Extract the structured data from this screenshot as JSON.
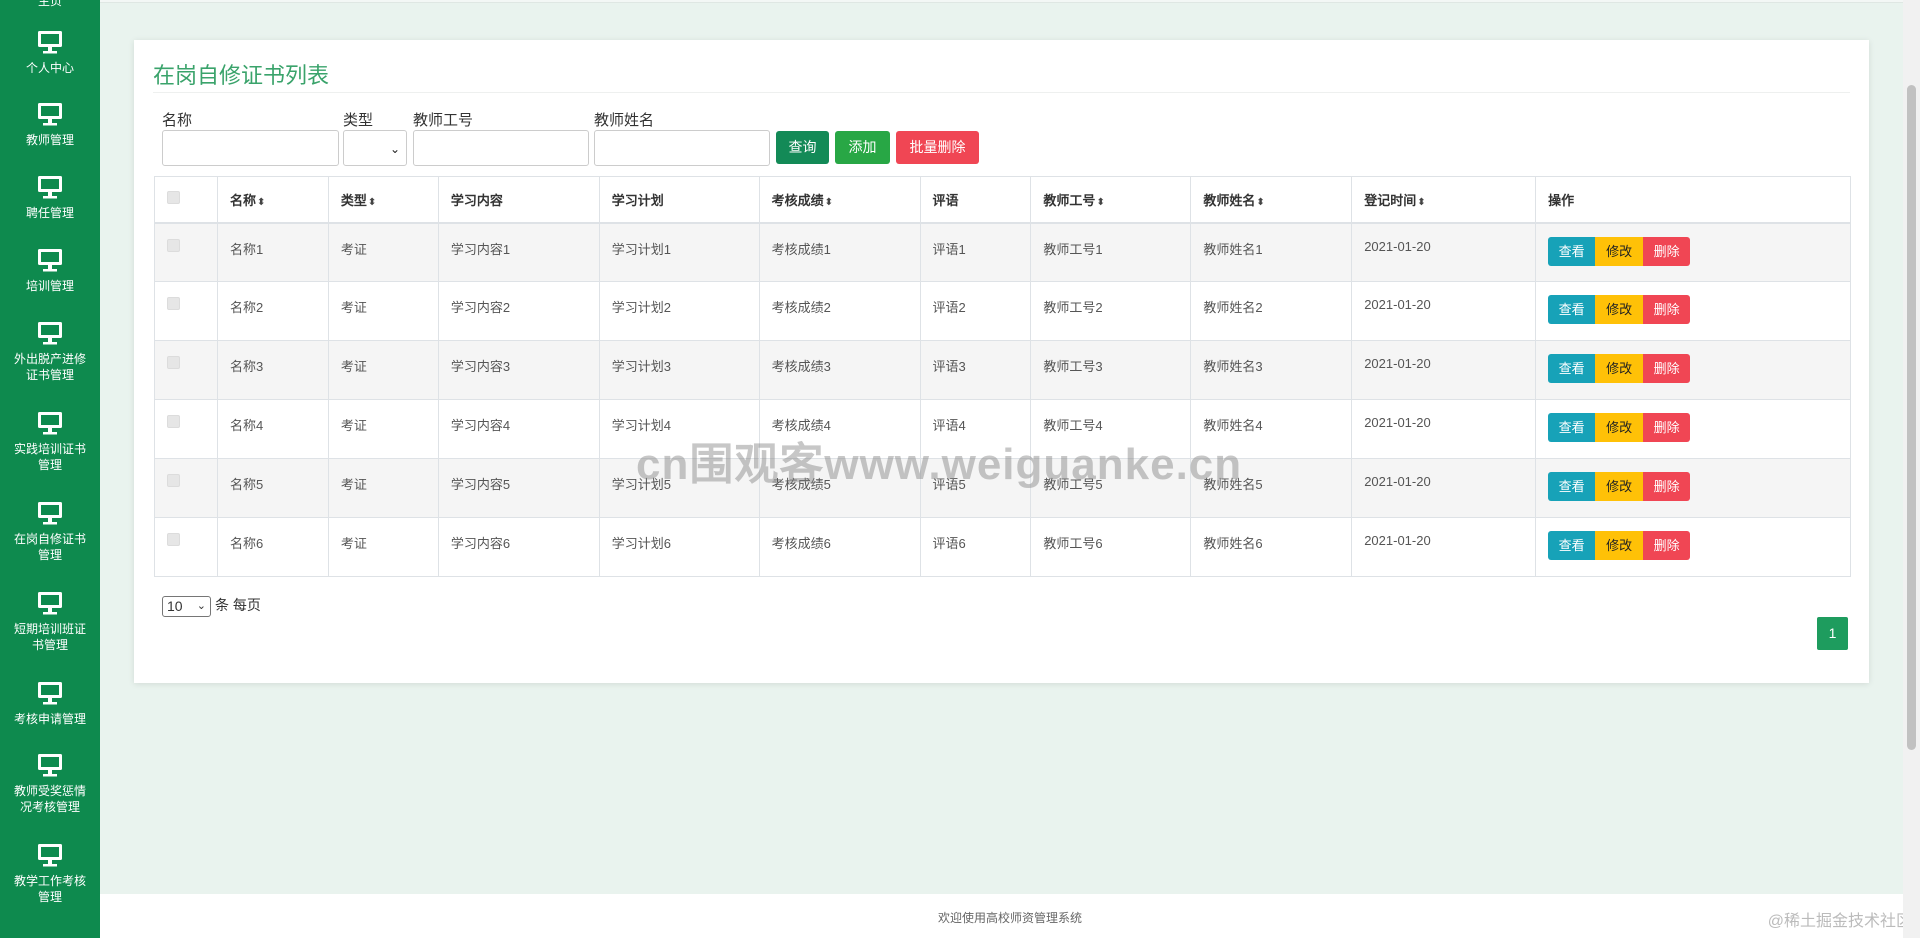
{
  "sidebar": {
    "top_clipped": "主页",
    "items": [
      {
        "label": "个人中心",
        "icon": "monitor-icon"
      },
      {
        "label": "教师管理",
        "icon": "monitor-icon"
      },
      {
        "label": "聘任管理",
        "icon": "monitor-icon"
      },
      {
        "label": "培训管理",
        "icon": "monitor-icon"
      },
      {
        "label": "外出脱产进修证书管理",
        "icon": "monitor-icon"
      },
      {
        "label": "实践培训证书管理",
        "icon": "monitor-icon"
      },
      {
        "label": "在岗自修证书管理",
        "icon": "monitor-icon"
      },
      {
        "label": "短期培训班证书管理",
        "icon": "monitor-icon"
      },
      {
        "label": "考核申请管理",
        "icon": "monitor-icon"
      },
      {
        "label": "教师受奖惩情况考核管理",
        "icon": "monitor-icon"
      },
      {
        "label": "教学工作考核管理",
        "icon": "monitor-icon"
      }
    ]
  },
  "page": {
    "title": "在岗自修证书列表"
  },
  "search": {
    "name_label": "名称",
    "type_label": "类型",
    "teacher_id_label": "教师工号",
    "teacher_name_label": "教师姓名",
    "query_button": "查询",
    "add_button": "添加",
    "bulk_delete_button": "批量删除"
  },
  "table": {
    "headers": [
      "名称",
      "类型",
      "学习内容",
      "学习计划",
      "考核成绩",
      "评语",
      "教师工号",
      "教师姓名",
      "登记时间",
      "操作"
    ],
    "rows": [
      [
        "名称1",
        "考证",
        "学习内容1",
        "学习计划1",
        "考核成绩1",
        "评语1",
        "教师工号1",
        "教师姓名1",
        "2021-01-20"
      ],
      [
        "名称2",
        "考证",
        "学习内容2",
        "学习计划2",
        "考核成绩2",
        "评语2",
        "教师工号2",
        "教师姓名2",
        "2021-01-20"
      ],
      [
        "名称3",
        "考证",
        "学习内容3",
        "学习计划3",
        "考核成绩3",
        "评语3",
        "教师工号3",
        "教师姓名3",
        "2021-01-20"
      ],
      [
        "名称4",
        "考证",
        "学习内容4",
        "学习计划4",
        "考核成绩4",
        "评语4",
        "教师工号4",
        "教师姓名4",
        "2021-01-20"
      ],
      [
        "名称5",
        "考证",
        "学习内容5",
        "学习计划5",
        "考核成绩5",
        "评语5",
        "教师工号5",
        "教师姓名5",
        "2021-01-20"
      ],
      [
        "名称6",
        "考证",
        "学习内容6",
        "学习计划6",
        "考核成绩6",
        "评语6",
        "教师工号6",
        "教师姓名6",
        "2021-01-20"
      ]
    ],
    "actions": {
      "view": "查看",
      "edit": "修改",
      "delete": "删除"
    }
  },
  "pager": {
    "per_page_value": "10",
    "per_page_suffix": "条 每页",
    "current_page": "1"
  },
  "footer": {
    "text": "欢迎使用高校师资管理系统",
    "corner": "@稀土掘金技术社区"
  },
  "watermark": "cn围观客www.weiguanke.cn",
  "colors": {
    "sidebar": "#0e8a4e",
    "title": "#3aa36b",
    "view": "#17a2b8",
    "edit": "#ffc107",
    "delete": "#f04654",
    "query": "#138a57",
    "add": "#28a745"
  }
}
